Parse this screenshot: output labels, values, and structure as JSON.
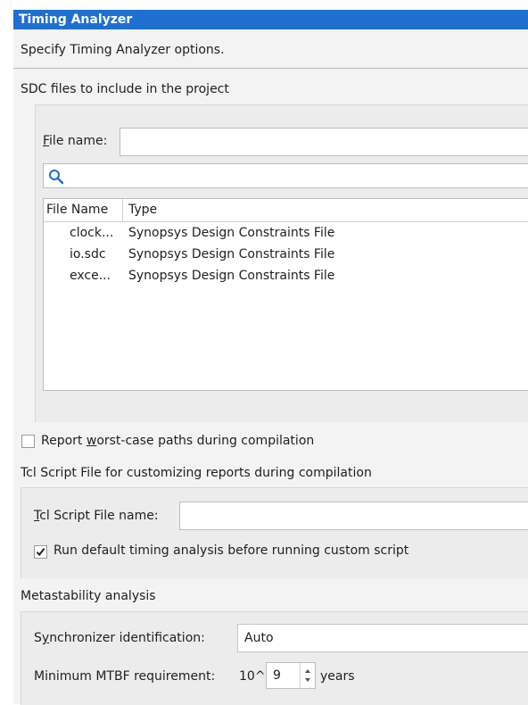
{
  "dialog": {
    "title": "Timing Analyzer",
    "description": "Specify Timing Analyzer options."
  },
  "sdc": {
    "section_label": "SDC files to include in the project",
    "file_name_label_prefix": "F",
    "file_name_label_rest": "ile name:",
    "file_name_value": "",
    "search_value": "",
    "columns": [
      "File Name",
      "Type"
    ],
    "rows": [
      {
        "name": "clock...",
        "type": "Synopsys Design Constraints File"
      },
      {
        "name": "io.sdc",
        "type": "Synopsys Design Constraints File"
      },
      {
        "name": "exce...",
        "type": "Synopsys Design Constraints File"
      }
    ]
  },
  "report_worst_case": {
    "label_pre": "Report ",
    "label_u": "w",
    "label_post": "orst-case paths during compilation",
    "checked": false
  },
  "tcl": {
    "section_label": "Tcl Script File for customizing reports during compilation",
    "name_label_u": "T",
    "name_label_rest": "cl Script File name:",
    "name_value": "",
    "run_default_label": "Run default timing analysis before running custom script",
    "run_default_checked": true
  },
  "metastability": {
    "section_label": "Metastability analysis",
    "sync_label_pre": "S",
    "sync_label_u": "y",
    "sync_label_post": "nchronizer identification:",
    "sync_value": "Auto",
    "mtbf_label": "Minimum MTBF requirement:",
    "mtbf_prefix": "10^",
    "mtbf_value": "9",
    "mtbf_units": "years"
  },
  "icons": {
    "search": "search-icon",
    "check": "check-icon",
    "spinner": "spinner-arrows-icon"
  },
  "colors": {
    "title_bar": "#1e6fd0",
    "search_icon": "#1a6fd3"
  }
}
